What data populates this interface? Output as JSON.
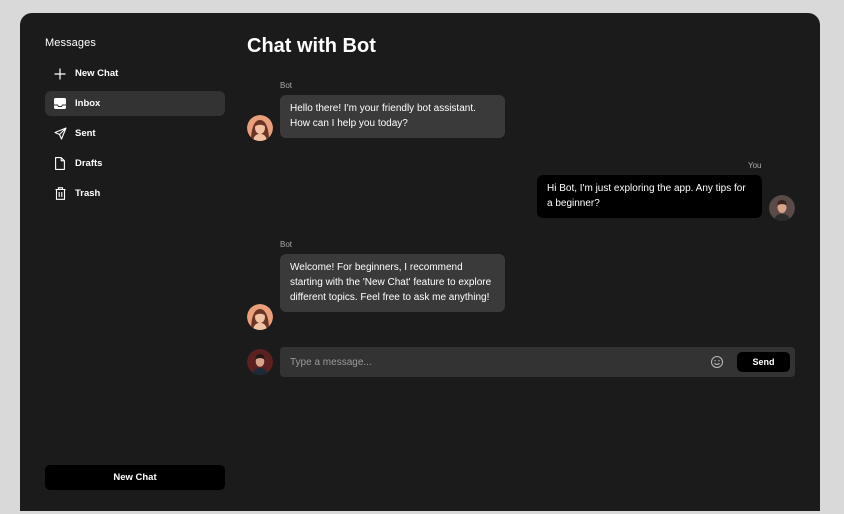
{
  "sidebar": {
    "title": "Messages",
    "items": [
      {
        "label": "New Chat",
        "icon": "plus-icon",
        "active": false
      },
      {
        "label": "Inbox",
        "icon": "inbox-icon",
        "active": true
      },
      {
        "label": "Sent",
        "icon": "send-icon",
        "active": false
      },
      {
        "label": "Drafts",
        "icon": "file-icon",
        "active": false
      },
      {
        "label": "Trash",
        "icon": "trash-icon",
        "active": false
      }
    ],
    "new_chat_button": "New Chat"
  },
  "chat": {
    "title": "Chat with Bot",
    "messages": [
      {
        "sender": "Bot",
        "text": "Hello there! I'm your friendly bot assistant. How can I help you today?"
      },
      {
        "sender": "You",
        "text": "Hi Bot, I'm just exploring the app. Any tips for a beginner?"
      },
      {
        "sender": "Bot",
        "text": "Welcome! For beginners, I recommend starting with the 'New Chat' feature to explore different topics. Feel free to ask me anything!"
      }
    ]
  },
  "composer": {
    "placeholder": "Type a message...",
    "emoji_icon": "smiley-icon",
    "send_label": "Send"
  },
  "colors": {
    "page_bg": "#d9d9d9",
    "window_bg": "#1b1b1b",
    "bot_bubble": "#3a3a3a",
    "user_bubble": "#000000",
    "active_nav": "#333333"
  }
}
